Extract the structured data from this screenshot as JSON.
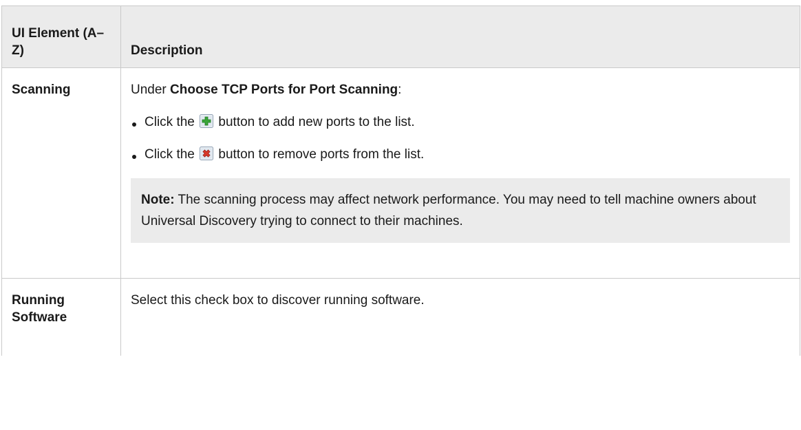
{
  "table": {
    "headers": [
      "UI Element (A–Z)",
      "Description"
    ],
    "rows": [
      {
        "element": "Scanning",
        "intro_prefix": "Under ",
        "intro_bold": "Choose TCP Ports for Port Scanning",
        "intro_suffix": ":",
        "bullets": [
          {
            "before": "Click the ",
            "icon": "add-icon",
            "after": " button to add new ports to the list."
          },
          {
            "before": "Click the ",
            "icon": "remove-icon",
            "after": " button to remove ports from the list."
          }
        ],
        "note_label": "Note:",
        "note_text": " The scanning process may affect network performance. You may need to tell machine owners about Universal Discovery trying to connect to their machines."
      },
      {
        "element": "Running Software",
        "description": "Select this check box to discover running software."
      }
    ]
  },
  "colors": {
    "header_bg": "#ebebeb",
    "note_bg": "#ebebeb",
    "border": "#c9c9c9",
    "add_icon_green": "#3aa53a",
    "remove_icon_red": "#d93a2b"
  }
}
